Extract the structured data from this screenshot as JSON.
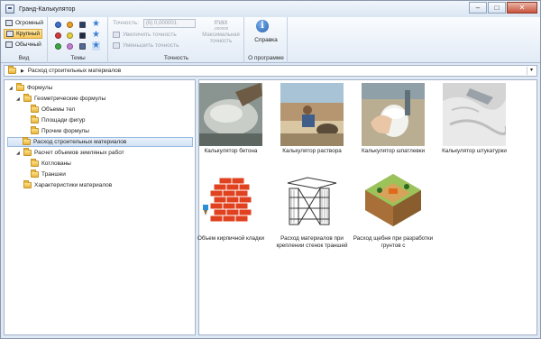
{
  "window": {
    "title": "Гранд-Калькулятор",
    "controls": {
      "minimize": "–",
      "maximize": "□",
      "close": "✕"
    }
  },
  "ribbon": {
    "view": {
      "label": "Вид",
      "items": [
        "Огромный",
        "Крупный",
        "Обычный"
      ],
      "selected": "Крупный"
    },
    "themes": {
      "label": "Темы"
    },
    "precision": {
      "label": "Точность",
      "field_label": "Точность:",
      "field_value": "(6) 0,000001",
      "increase": "Увеличить точность",
      "decrease": "Уменьшить точность",
      "max_icon_top": "max",
      "max_icon_bottom": ",000000",
      "max_label_1": "Максимальная",
      "max_label_2": "точность"
    },
    "about": {
      "label": "О программе",
      "help": "Справка"
    }
  },
  "address": {
    "path": "Расход строительных материалов"
  },
  "tree": [
    {
      "label": "Формулы",
      "level": 0,
      "expanded": true
    },
    {
      "label": "Геометрические формулы",
      "level": 1,
      "expanded": true
    },
    {
      "label": "Объемы тел",
      "level": 2
    },
    {
      "label": "Площади фигур",
      "level": 2
    },
    {
      "label": "Прочие формулы",
      "level": 2
    },
    {
      "label": "Расход строительных материалов",
      "level": 1,
      "selected": true
    },
    {
      "label": "Расчет объемов земляных работ",
      "level": 1,
      "expanded": true
    },
    {
      "label": "Котлованы",
      "level": 2
    },
    {
      "label": "Траншеи",
      "level": 2
    },
    {
      "label": "Характеристики материалов",
      "level": 1
    }
  ],
  "tiles": [
    {
      "label": "Калькулятор бетона"
    },
    {
      "label": "Калькулятор раствора"
    },
    {
      "label": "Калькулятор шпатлевки"
    },
    {
      "label": "Калькулятор штукатурки"
    },
    {
      "label": "Объем кирпичной кладки"
    },
    {
      "label": "Расход материалов при креплении стенок траншей"
    },
    {
      "label": "Расход щебня при разработки грунтов с"
    }
  ],
  "colors": {
    "accent": "#f9c95b",
    "selection": "#d2e2f5",
    "chrome": "#dfe9f5"
  }
}
